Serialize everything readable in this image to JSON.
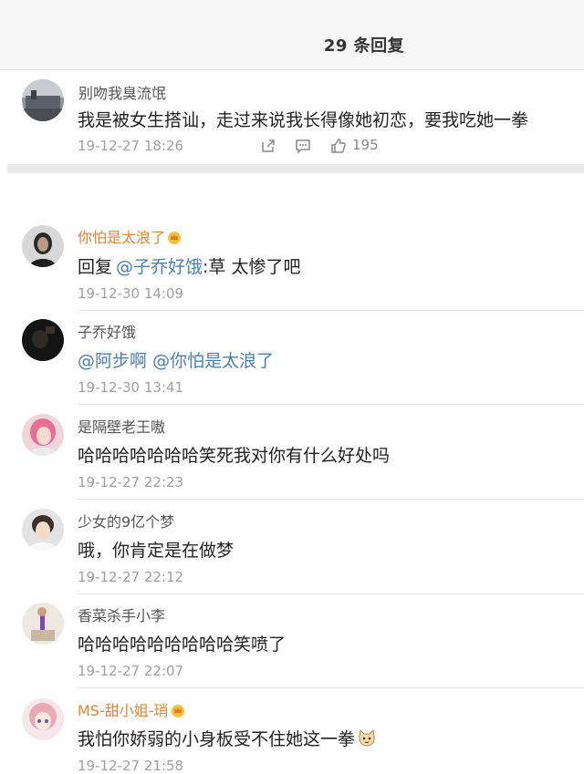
{
  "header": {
    "title": "29 条回复"
  },
  "root_comment": {
    "user": "别吻我臭流氓",
    "text": "我是被女生搭讪，走过来说我长得像她初恋，要我吃她一拳",
    "time": "19-12-27 18:26",
    "likes": "195",
    "icons": [
      "share-icon",
      "comment-icon",
      "thumbs-up-icon"
    ]
  },
  "replies": [
    {
      "user": "你怕是太浪了",
      "user_style": "vip",
      "badge": "crown-icon",
      "prefix": "回复",
      "mention": "@子乔好饿",
      "text": ":草 太惨了吧",
      "time": "19-12-30 14:09"
    },
    {
      "user": "子乔好饿",
      "mention1": "@阿步啊",
      "mention2": "@你怕是太浪了",
      "time": "19-12-30 13:41"
    },
    {
      "user": "是隔壁老王嗷",
      "text": "哈哈哈哈哈哈哈笑死我对你有什么好处吗",
      "time": "19-12-27 22:23"
    },
    {
      "user": "少女的9亿个梦",
      "text": "哦，你肯定是在做梦",
      "time": "19-12-27 22:12"
    },
    {
      "user": "香菜杀手小李",
      "text": "哈哈哈哈哈哈哈哈哈笑喷了",
      "time": "19-12-27 22:07"
    },
    {
      "user": "MS-甜小姐-琑",
      "user_style": "vip",
      "badge": "crown-icon",
      "text": "我怕你娇弱的小身板受不住她这一拳",
      "emoji": "cat-face-emoji",
      "time": "19-12-27 21:58"
    }
  ],
  "colors": {
    "mention": "#4a7fb0",
    "vip_name": "#e8832f",
    "time": "#a0a0a0"
  }
}
